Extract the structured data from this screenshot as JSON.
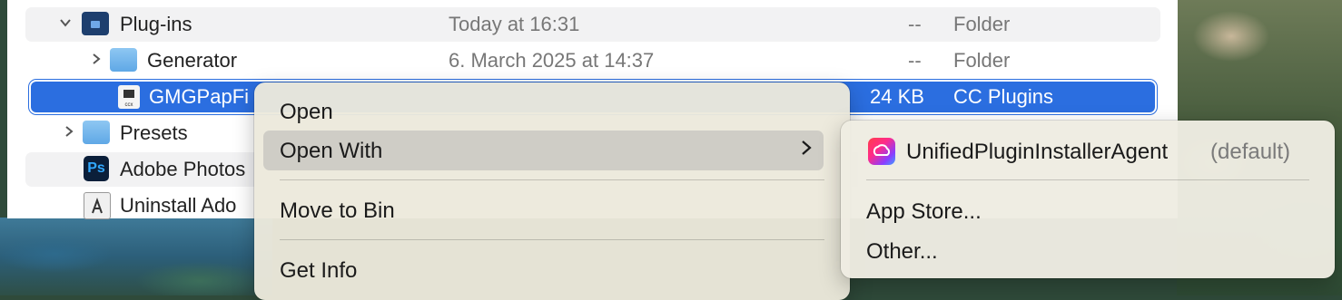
{
  "finder": {
    "rows": [
      {
        "name": "Plug-ins",
        "date": "Today at 16:31",
        "size": "--",
        "kind": "Folder"
      },
      {
        "name": "Generator",
        "date": "6. March 2025 at 14:37",
        "size": "--",
        "kind": "Folder"
      },
      {
        "name": "GMGPapFi",
        "size": "24 KB",
        "kind": "CC Plugins",
        "badge": "ccx"
      },
      {
        "name": "Presets"
      },
      {
        "name": "Adobe Photos",
        "badge": "Ps"
      },
      {
        "name": "Uninstall Ado"
      }
    ]
  },
  "context_menu": {
    "items": [
      "Open",
      "Open With",
      "Move to Bin",
      "Get Info"
    ]
  },
  "submenu": {
    "default_app": "UnifiedPluginInstallerAgent",
    "default_suffix": "(default)",
    "app_store": "App Store...",
    "other": "Other..."
  },
  "icons": {
    "chevron_down": "chevron-down-icon",
    "chevron_right": "chevron-right-icon",
    "submenu_arrow": "chevron-right-icon"
  },
  "colors": {
    "selection": "#2b6ee0",
    "folder_light": "#6eb4ec",
    "folder_dark": "#1e3f6e"
  }
}
